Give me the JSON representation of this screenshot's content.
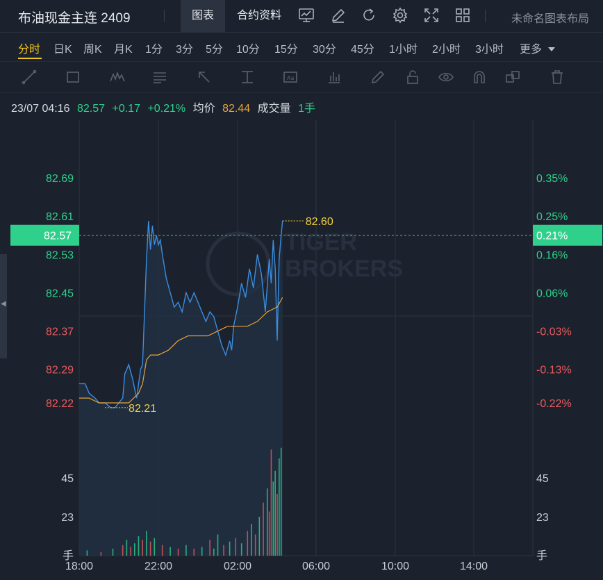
{
  "header": {
    "instrument_title": "布油现金主连 2409",
    "tabs": [
      "图表",
      "合约资料"
    ],
    "layout_name": "未命名图表布局",
    "icons": [
      "chart-settings-icon",
      "edit-icon",
      "refresh-icon",
      "gear-icon",
      "fullscreen-icon",
      "grid-layout-icon"
    ]
  },
  "timeframes": {
    "items": [
      "分时",
      "日K",
      "周K",
      "月K",
      "1分",
      "3分",
      "5分",
      "10分",
      "15分",
      "30分",
      "45分",
      "1小时",
      "2小时",
      "3小时"
    ],
    "more_label": "更多",
    "active": "分时"
  },
  "drawing_tools": [
    "line-tool-icon",
    "rectangle-tool-icon",
    "pattern-tool-icon",
    "fib-tool-icon",
    "arrow-tool-icon",
    "measure-tool-icon",
    "text-tool-icon",
    "bar-tool-icon",
    "pen-icon",
    "lock-icon",
    "eye-icon",
    "magnet-icon",
    "duplicate-icon",
    "trash-icon"
  ],
  "info": {
    "datetime": "23/07 04:16",
    "price": "82.57",
    "change": "+0.17",
    "change_pct": "+0.21%",
    "avg_label": "均价",
    "avg_value": "82.44",
    "volume_label": "成交量",
    "volume_value": "1手"
  },
  "colors": {
    "up": "#2fd08b",
    "down": "#e8595c",
    "price_line": "#3b8de0",
    "avg_line": "#e9a23b",
    "marker": "#f3d23a",
    "background": "#1c222d"
  },
  "chart_data": {
    "type": "line",
    "watermark": "TIGER BROKERS",
    "x_ticks": [
      "18:00",
      "22:00",
      "02:00",
      "06:00",
      "10:00",
      "14:00"
    ],
    "price_axis_left": [
      "82.69",
      "82.61",
      "82.53",
      "82.45",
      "82.37",
      "82.29",
      "82.22"
    ],
    "pct_axis_right": [
      "0.35%",
      "0.25%",
      "0.16%",
      "0.06%",
      "-0.03%",
      "-0.13%",
      "-0.22%"
    ],
    "ylim": [
      82.195,
      82.75
    ],
    "current_price_label": "82.57",
    "current_pct_label": "0.21%",
    "high_label": "82.60",
    "low_label": "82.21",
    "volume_axis": [
      "45",
      "23",
      "手"
    ],
    "volume_ylim": [
      0,
      70
    ],
    "series": [
      {
        "name": "price",
        "x_hours": [
          0,
          0.3,
          0.5,
          0.8,
          1.0,
          1.3,
          1.6,
          1.8,
          2.0,
          2.2,
          2.3,
          2.5,
          2.7,
          2.9,
          3.0,
          3.1,
          3.2,
          3.4,
          3.5,
          3.6,
          3.7,
          3.8,
          3.9,
          4.0,
          4.1,
          4.2,
          4.4,
          4.6,
          4.8,
          5.0,
          5.2,
          5.4,
          5.6,
          5.8,
          6.0,
          6.2,
          6.4,
          6.6,
          6.8,
          7.0,
          7.2,
          7.4,
          7.6,
          7.7,
          7.8,
          8.0,
          8.2,
          8.4,
          8.6,
          8.8,
          9.0,
          9.2,
          9.4,
          9.6,
          9.7,
          9.8,
          9.9,
          10.0,
          10.1,
          10.2,
          10.27
        ],
        "values": [
          82.26,
          82.26,
          82.24,
          82.23,
          82.22,
          82.22,
          82.21,
          82.21,
          82.22,
          82.23,
          82.28,
          82.3,
          82.27,
          82.23,
          82.26,
          82.29,
          82.3,
          82.52,
          82.6,
          82.54,
          82.59,
          82.55,
          82.57,
          82.55,
          82.56,
          82.53,
          82.48,
          82.45,
          82.42,
          82.43,
          82.41,
          82.45,
          82.43,
          82.45,
          82.43,
          82.41,
          82.39,
          82.41,
          82.4,
          82.37,
          82.34,
          82.32,
          82.35,
          82.33,
          82.38,
          82.42,
          82.47,
          82.44,
          82.5,
          82.46,
          82.53,
          82.49,
          82.41,
          82.52,
          82.47,
          82.56,
          82.5,
          82.35,
          82.52,
          82.57,
          82.6
        ]
      },
      {
        "name": "average",
        "x_hours": [
          0,
          0.5,
          1.0,
          1.5,
          2.0,
          2.5,
          3.0,
          3.2,
          3.4,
          3.6,
          4.0,
          4.5,
          5.0,
          5.5,
          6.0,
          6.5,
          7.0,
          7.5,
          8.0,
          8.5,
          9.0,
          9.5,
          10.0,
          10.27
        ],
        "values": [
          82.23,
          82.23,
          82.22,
          82.22,
          82.22,
          82.22,
          82.24,
          82.26,
          82.31,
          82.32,
          82.32,
          82.33,
          82.35,
          82.36,
          82.36,
          82.36,
          82.37,
          82.38,
          82.38,
          82.38,
          82.39,
          82.41,
          82.42,
          82.44
        ]
      }
    ],
    "volume_bars": [
      {
        "x_hours": 0.4,
        "value": 3,
        "dir": "up"
      },
      {
        "x_hours": 1.1,
        "value": 2,
        "dir": "down"
      },
      {
        "x_hours": 1.7,
        "value": 4,
        "dir": "up"
      },
      {
        "x_hours": 2.2,
        "value": 6,
        "dir": "down"
      },
      {
        "x_hours": 2.4,
        "value": 9,
        "dir": "up"
      },
      {
        "x_hours": 2.6,
        "value": 5,
        "dir": "down"
      },
      {
        "x_hours": 2.8,
        "value": 7,
        "dir": "up"
      },
      {
        "x_hours": 3.0,
        "value": 11,
        "dir": "up"
      },
      {
        "x_hours": 3.2,
        "value": 9,
        "dir": "down"
      },
      {
        "x_hours": 3.4,
        "value": 14,
        "dir": "up"
      },
      {
        "x_hours": 3.6,
        "value": 8,
        "dir": "down"
      },
      {
        "x_hours": 3.8,
        "value": 10,
        "dir": "up"
      },
      {
        "x_hours": 4.2,
        "value": 6,
        "dir": "down"
      },
      {
        "x_hours": 4.6,
        "value": 5,
        "dir": "up"
      },
      {
        "x_hours": 5.0,
        "value": 4,
        "dir": "down"
      },
      {
        "x_hours": 5.4,
        "value": 6,
        "dir": "up"
      },
      {
        "x_hours": 5.8,
        "value": 4,
        "dir": "down"
      },
      {
        "x_hours": 6.2,
        "value": 5,
        "dir": "up"
      },
      {
        "x_hours": 6.6,
        "value": 9,
        "dir": "down"
      },
      {
        "x_hours": 6.8,
        "value": 4,
        "dir": "up"
      },
      {
        "x_hours": 7.0,
        "value": 12,
        "dir": "up"
      },
      {
        "x_hours": 7.3,
        "value": 6,
        "dir": "down"
      },
      {
        "x_hours": 7.6,
        "value": 8,
        "dir": "up"
      },
      {
        "x_hours": 7.9,
        "value": 10,
        "dir": "down"
      },
      {
        "x_hours": 8.2,
        "value": 7,
        "dir": "up"
      },
      {
        "x_hours": 8.5,
        "value": 14,
        "dir": "down"
      },
      {
        "x_hours": 8.7,
        "value": 18,
        "dir": "up"
      },
      {
        "x_hours": 8.9,
        "value": 12,
        "dir": "down"
      },
      {
        "x_hours": 9.1,
        "value": 22,
        "dir": "up"
      },
      {
        "x_hours": 9.3,
        "value": 30,
        "dir": "down"
      },
      {
        "x_hours": 9.5,
        "value": 38,
        "dir": "up"
      },
      {
        "x_hours": 9.6,
        "value": 25,
        "dir": "down"
      },
      {
        "x_hours": 9.7,
        "value": 60,
        "dir": "down"
      },
      {
        "x_hours": 9.8,
        "value": 42,
        "dir": "up"
      },
      {
        "x_hours": 9.9,
        "value": 48,
        "dir": "up"
      },
      {
        "x_hours": 10.0,
        "value": 35,
        "dir": "down"
      },
      {
        "x_hours": 10.1,
        "value": 55,
        "dir": "up"
      },
      {
        "x_hours": 10.2,
        "value": 61,
        "dir": "up"
      }
    ]
  }
}
